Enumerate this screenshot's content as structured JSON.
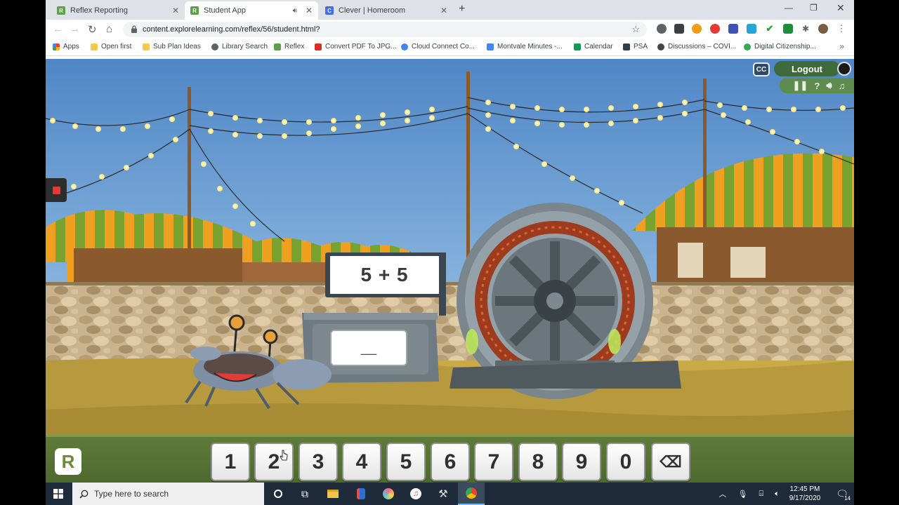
{
  "browser": {
    "tabs": [
      {
        "label": "Reflex Reporting",
        "favicon": "reflex-favicon",
        "active": false
      },
      {
        "label": "Student App",
        "favicon": "reflex-favicon",
        "active": true
      },
      {
        "label": "Clever | Homeroom",
        "favicon": "clever-favicon",
        "active": false
      }
    ],
    "url": "content.explorelearning.com/reflex/56/student.html?",
    "bookmarks": [
      {
        "label": "Apps",
        "icon": "apps-grid-icon"
      },
      {
        "label": "Open first",
        "icon": "folder-icon"
      },
      {
        "label": "Sub Plan Ideas",
        "icon": "folder-icon"
      },
      {
        "label": "Library Search",
        "icon": "globe-icon"
      },
      {
        "label": "Reflex",
        "icon": "reflex-favicon"
      },
      {
        "label": "Convert PDF To JPG...",
        "icon": "pdf-icon"
      },
      {
        "label": "Cloud Connect Co...",
        "icon": "google-icon"
      },
      {
        "label": "Montvale Minutes -...",
        "icon": "docs-icon"
      },
      {
        "label": "Calendar",
        "icon": "calendar-icon"
      },
      {
        "label": "PSA",
        "icon": "psa-icon"
      },
      {
        "label": "Discussions – COVI...",
        "icon": "wordpress-icon"
      },
      {
        "label": "Digital Citizenship...",
        "icon": "check-icon"
      }
    ]
  },
  "game": {
    "problem": "5 + 5",
    "answer_placeholder": "__",
    "cc_label": "CC",
    "logout_label": "Logout",
    "logo_letter": "R",
    "keypad": [
      "1",
      "2",
      "3",
      "4",
      "5",
      "6",
      "7",
      "8",
      "9",
      "0"
    ],
    "backspace_symbol": "⌫",
    "controls": [
      "pause-icon",
      "help-icon",
      "sound-icon",
      "music-icon"
    ]
  },
  "taskbar": {
    "search_placeholder": "Type here to search",
    "time": "12:45 PM",
    "date": "9/17/2020",
    "notification_count": "14"
  },
  "colors": {
    "sky": "#6b9fd4",
    "tent_orange": "#f0a020",
    "tent_green": "#7aa22e",
    "keypad_bar": "#5f7b3a",
    "logout_green": "#3e6b3c"
  }
}
